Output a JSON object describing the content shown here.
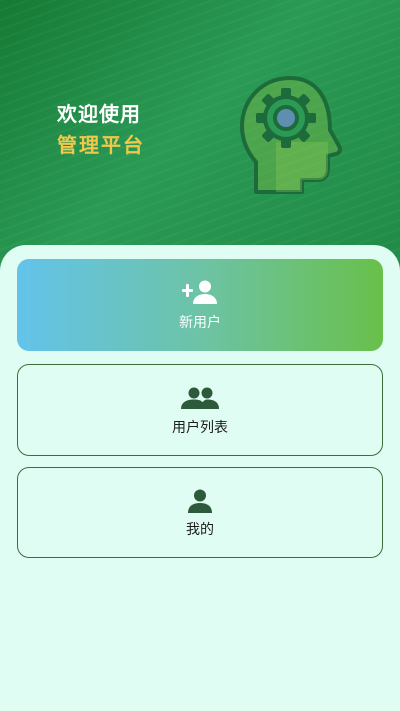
{
  "header": {
    "welcome": "欢迎使用",
    "platform": "管理平台",
    "illustration_icon": "head-gear-icon",
    "welcome_color": "#ffffff",
    "platform_color": "#f2c84b"
  },
  "menu": {
    "items": [
      {
        "label": "新用户",
        "icon": "add-user-icon"
      },
      {
        "label": "用户列表",
        "icon": "users-icon"
      },
      {
        "label": "我的",
        "icon": "person-icon"
      }
    ]
  },
  "colors": {
    "hero_green": "#1f8a45",
    "panel_bg": "#dffdf3",
    "card_border": "#3c6e3c",
    "icon_dark": "#2d5a3a"
  }
}
